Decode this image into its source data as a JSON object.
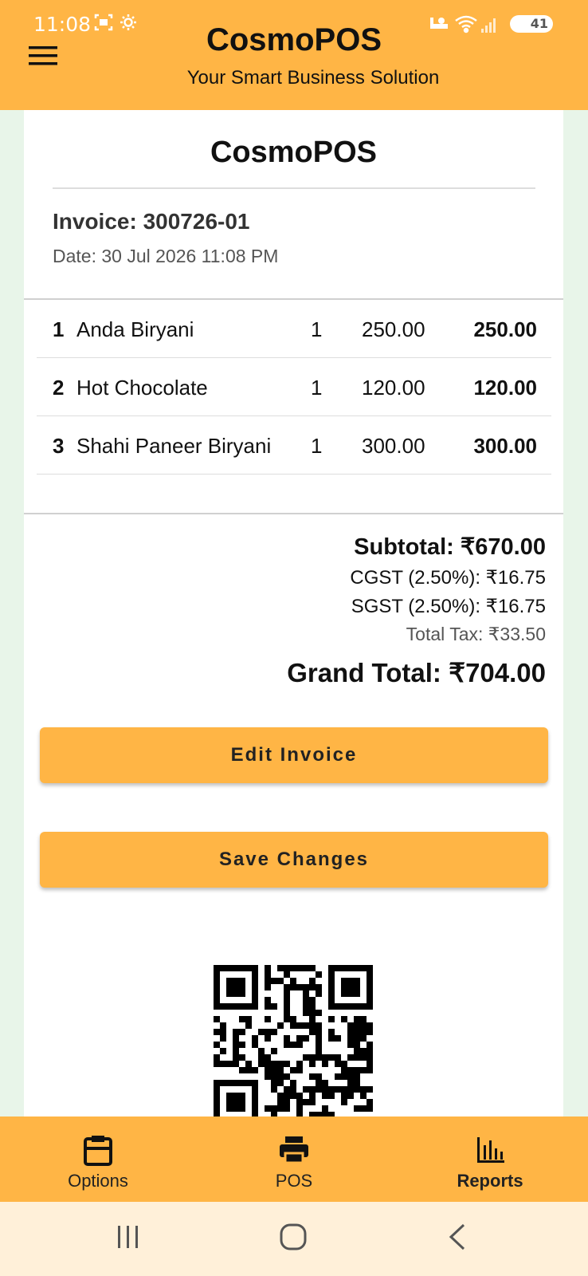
{
  "status_bar": {
    "time": "11:08",
    "battery": "41",
    "icons_left": [
      "screenshot-icon",
      "settings-icon"
    ],
    "icons_right": [
      "alarm-icon",
      "wifi-icon",
      "signal-icon",
      "battery-icon"
    ]
  },
  "header": {
    "title": "CosmoPOS",
    "subtitle": "Your Smart Business Solution",
    "menu_icon": "hamburger-menu-icon"
  },
  "receipt": {
    "title": "CosmoPOS",
    "invoice_label": "Invoice: 300726-01",
    "date_label": "Date: 30 Jul 2026 11:08 PM",
    "items": [
      {
        "index": "1",
        "name": "Anda Biryani",
        "qty": "1",
        "price": "250.00",
        "amount": "250.00"
      },
      {
        "index": "2",
        "name": "Hot Chocolate",
        "qty": "1",
        "price": "120.00",
        "amount": "120.00"
      },
      {
        "index": "3",
        "name": "Shahi Paneer Biryani",
        "qty": "1",
        "price": "300.00",
        "amount": "300.00"
      }
    ],
    "totals": {
      "subtotal": "Subtotal: ₹670.00",
      "cgst": "CGST (2.50%): ₹16.75",
      "sgst": "SGST (2.50%): ₹16.75",
      "total_tax": "Total Tax: ₹33.50",
      "grand_total": "Grand Total: ₹704.00"
    }
  },
  "actions": {
    "edit_label": "Edit Invoice",
    "save_label": "Save Changes"
  },
  "bottom_nav": {
    "items": [
      {
        "label": "Options",
        "icon": "clipboard-icon"
      },
      {
        "label": "POS",
        "icon": "printer-icon"
      },
      {
        "label": "Reports",
        "icon": "bar-chart-icon",
        "active": true
      }
    ]
  },
  "system_nav": [
    "recent-apps-icon",
    "home-icon",
    "back-icon"
  ],
  "colors": {
    "accent": "#FFB545",
    "background": "#E8F5E9",
    "system_nav": "#FFF0D9"
  }
}
